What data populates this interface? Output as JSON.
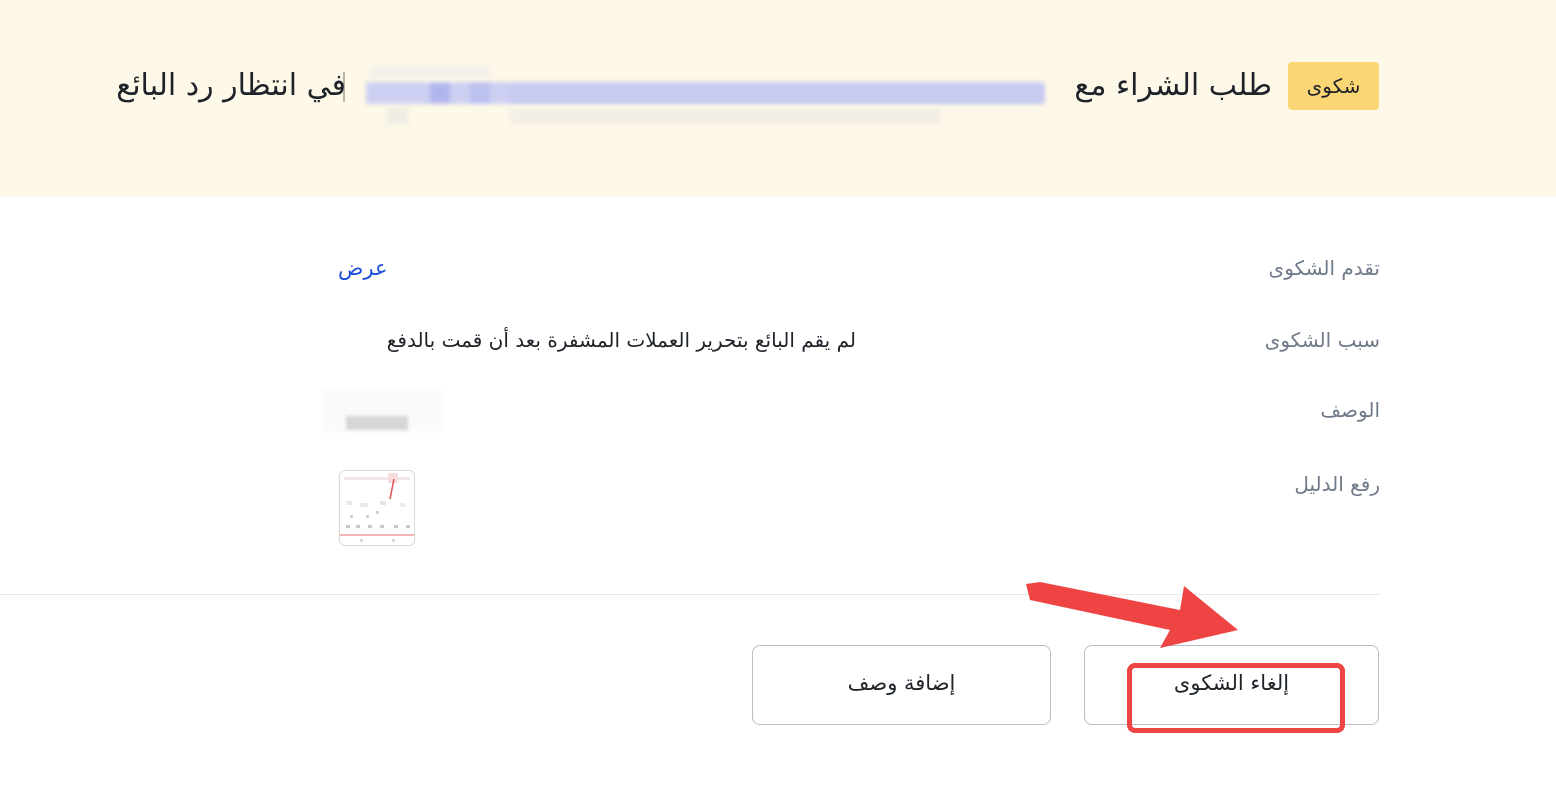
{
  "header": {
    "badge": "شكوى",
    "title_prefix": "طلب الشراء مع",
    "title_suffix": "في انتظار رد البائع"
  },
  "details": {
    "progress_label": "تقدم الشكوى",
    "progress_link": "عرض",
    "reason_label": "سبب الشكوى",
    "reason_value": "لم يقم البائع بتحرير العملات المشفرة بعد أن قمت بالدفع",
    "description_label": "الوصف",
    "evidence_label": "رفع الدليل"
  },
  "actions": {
    "cancel_label": "إلغاء الشكوى",
    "add_description_label": "إضافة وصف"
  },
  "colors": {
    "banner_bg": "#fef8e8",
    "badge_bg": "#fcd574",
    "link": "#1b4fd8",
    "annotation": "#ef4444"
  }
}
